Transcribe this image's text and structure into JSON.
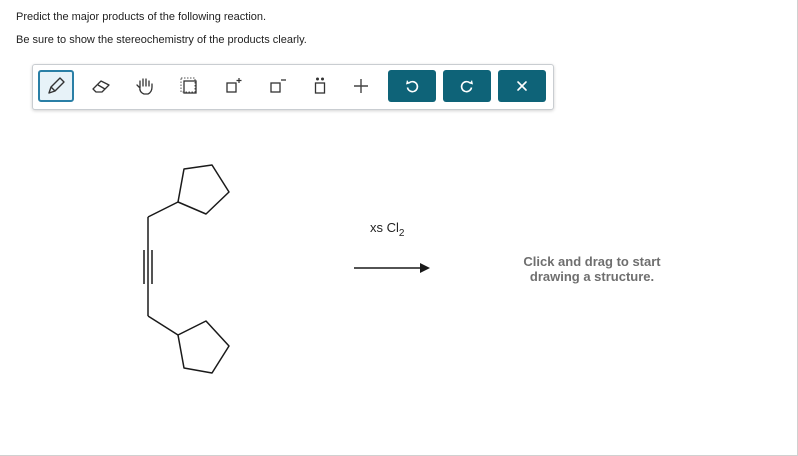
{
  "question": {
    "line1": "Predict the major products of the following reaction.",
    "line2": "Be sure to show the stereochemistry of the products clearly."
  },
  "toolbar": {
    "tools": [
      {
        "name": "pencil-tool",
        "icon": "pencil-icon",
        "active": true
      },
      {
        "name": "eraser-tool",
        "icon": "eraser-icon"
      },
      {
        "name": "hand-tool",
        "icon": "hand-icon"
      },
      {
        "name": "select-tool",
        "icon": "selection-box-icon"
      },
      {
        "name": "positive-charge-tool",
        "icon": "positive-charge-icon"
      },
      {
        "name": "negative-charge-tool",
        "icon": "negative-charge-icon"
      },
      {
        "name": "lone-pair-tool",
        "icon": "lone-pair-icon"
      },
      {
        "name": "add-tool",
        "icon": "plus-icon"
      },
      {
        "name": "undo-button",
        "icon": "undo-icon"
      },
      {
        "name": "redo-button",
        "icon": "redo-icon"
      },
      {
        "name": "clear-button",
        "icon": "close-icon"
      }
    ],
    "accent_color": "#0e6378"
  },
  "reaction": {
    "reagent_text": "xs Cl",
    "reagent_subscript": "2"
  },
  "canvas": {
    "hint_line1": "Click and drag to start",
    "hint_line2": "drawing a structure."
  }
}
